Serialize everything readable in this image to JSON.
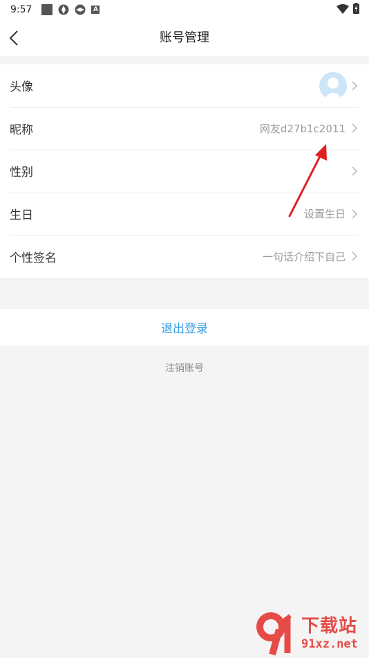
{
  "status_bar": {
    "time": "9:57",
    "icons_left": [
      "notification-square-icon",
      "aperture-icon",
      "aperture-icon",
      "a-icon"
    ],
    "icons_right": [
      "wifi-icon",
      "battery-charging-icon"
    ]
  },
  "nav": {
    "title": "账号管理",
    "back_icon": "chevron-left-icon"
  },
  "rows": [
    {
      "label": "头像",
      "value": "",
      "has_avatar": true
    },
    {
      "label": "昵称",
      "value": "网友d27b1c2011"
    },
    {
      "label": "性别",
      "value": ""
    },
    {
      "label": "生日",
      "value": "设置生日"
    },
    {
      "label": "个性签名",
      "value": "一句话介绍下自己"
    }
  ],
  "logout": {
    "label": "退出登录"
  },
  "cancel_account": {
    "label": "注销账号"
  },
  "watermark": {
    "cn": "下载站",
    "url": "91xz.net"
  },
  "colors": {
    "accent_blue": "#2f9de4",
    "background": "#f4f4f4",
    "arrow_red": "#e02020",
    "watermark_red": "#e53935"
  }
}
